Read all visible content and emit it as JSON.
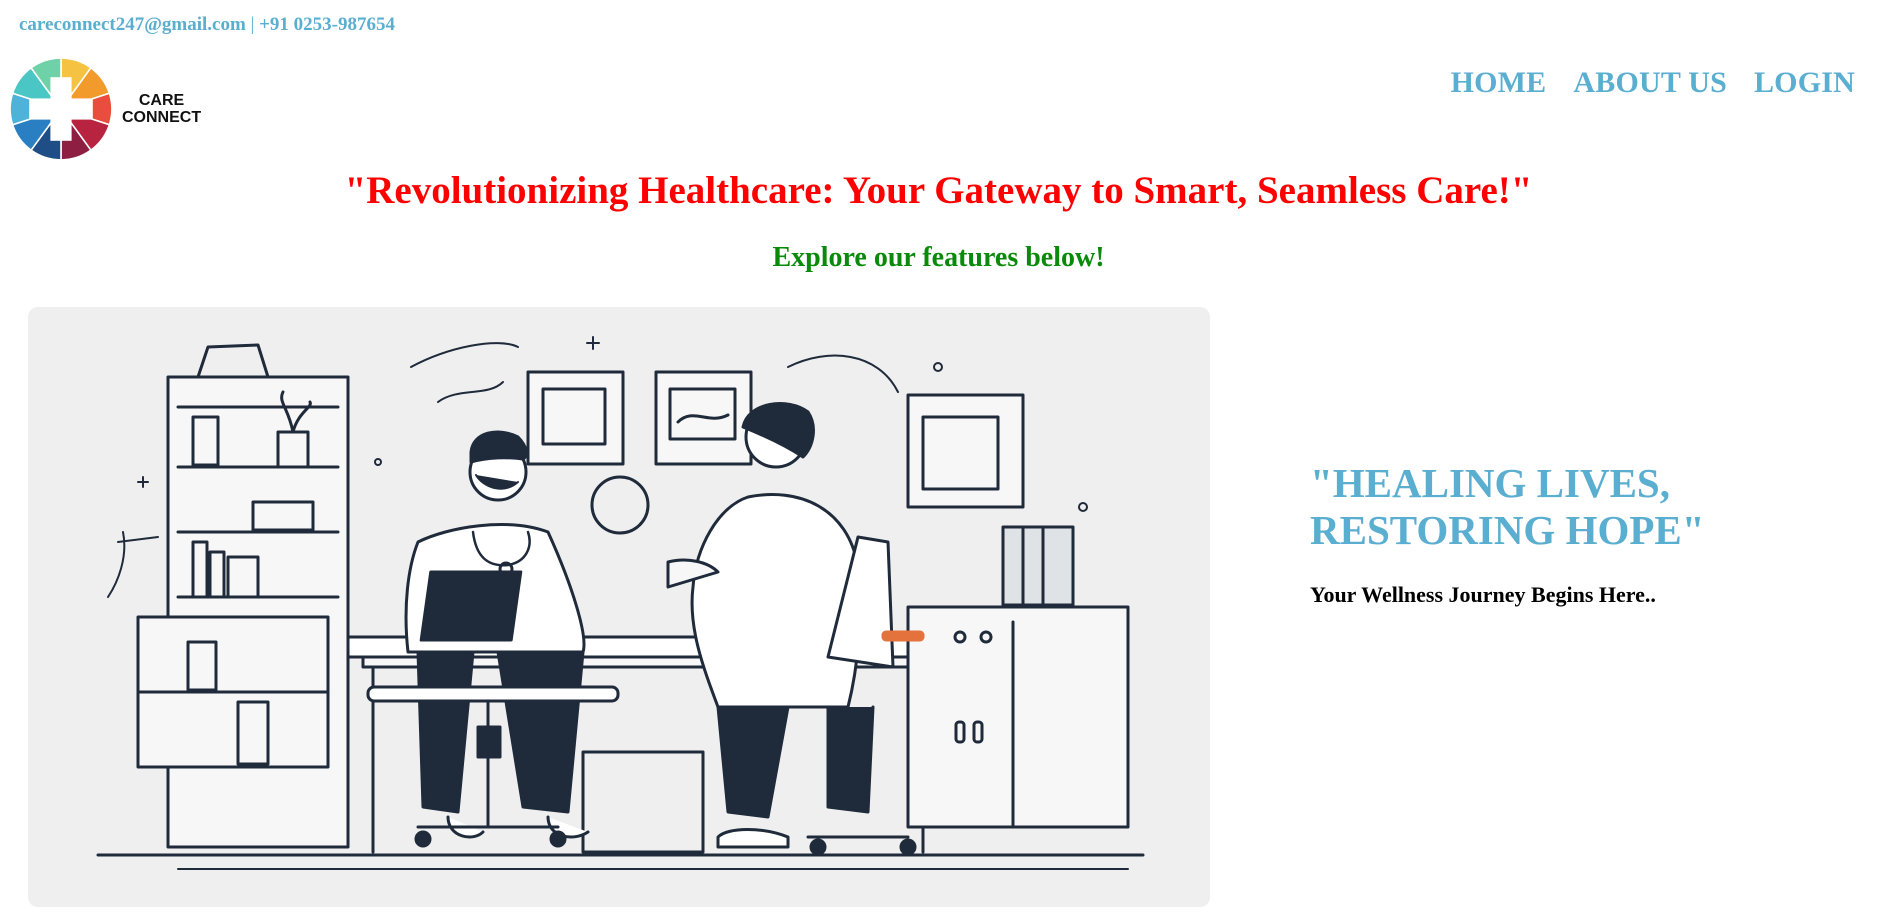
{
  "topbar": {
    "email": "careconnect247@gmail.com",
    "separator": "|",
    "phone": "+91 0253-987654"
  },
  "brand": {
    "logo_line1": "CARE",
    "logo_line2": "CONNECT",
    "logo_colors": [
      "#f5c242",
      "#f39a2c",
      "#e84d3d",
      "#b8233f",
      "#8e1f43",
      "#1f4e86",
      "#2a7ec2",
      "#4fb3d9",
      "#4ac6c4",
      "#6fd1a8"
    ]
  },
  "nav": {
    "items": [
      {
        "label": "HOME"
      },
      {
        "label": "ABOUT US"
      },
      {
        "label": "LOGIN"
      }
    ]
  },
  "hero": {
    "headline": "\"Revolutionizing Healthcare: Your Gateway to Smart, Seamless Care!\"",
    "subline": "Explore our features below!"
  },
  "side": {
    "title_line1": "\"HEALING LIVES,",
    "title_line2": "RESTORING HOPE\"",
    "subtitle": "Your Wellness Journey Begins Here.."
  },
  "colors": {
    "accent": "#5aaed0",
    "headline": "#ff0000",
    "subline": "#0a8a0a",
    "ink": "#1f2a3a"
  }
}
